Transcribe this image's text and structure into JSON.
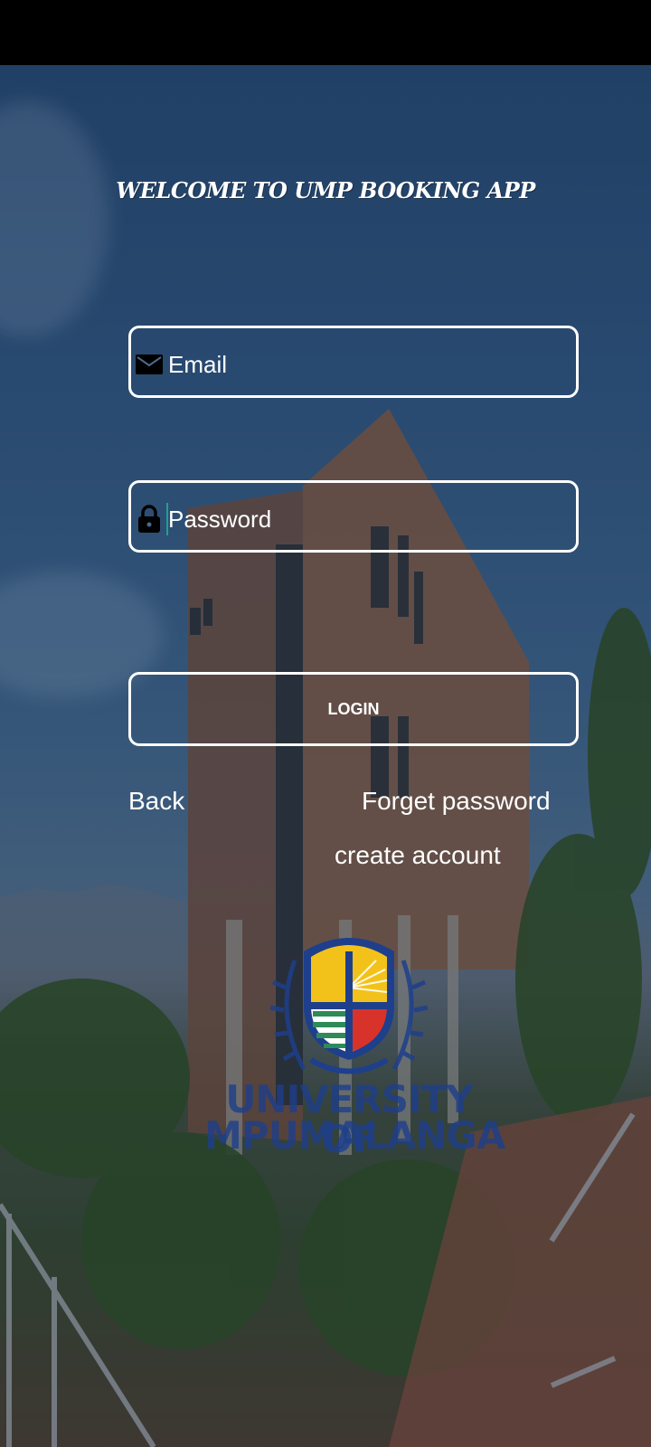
{
  "header": {
    "title": "WELCOME TO UMP BOOKING APP"
  },
  "form": {
    "email": {
      "placeholder": "Email",
      "icon": "envelope-icon"
    },
    "password": {
      "placeholder": "Password",
      "icon": "lock-icon"
    },
    "login_label": "LOGIN"
  },
  "links": {
    "back": "Back",
    "forget_password": "Forget password",
    "create_account": "create account"
  },
  "logo": {
    "line1": "UNIVERSITY OF",
    "line2": "MPUMALANGA"
  },
  "colors": {
    "logo_blue": "#1e3f8c",
    "logo_yellow": "#f3c21a",
    "logo_red": "#d8332a",
    "logo_green": "#2e8b57"
  }
}
